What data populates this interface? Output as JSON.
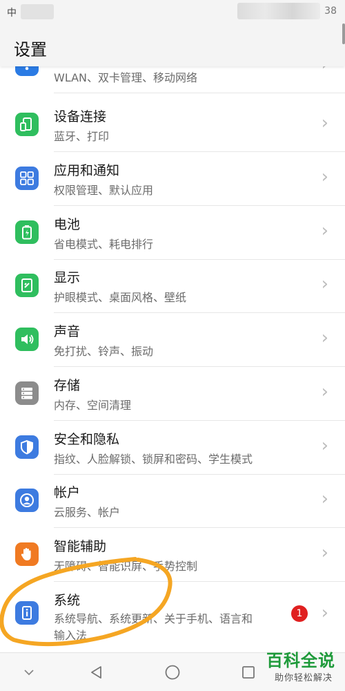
{
  "status_bar": {
    "left_text": "中",
    "right_text": "38"
  },
  "header": {
    "title": "设置"
  },
  "settings": [
    {
      "title": "",
      "subtitle": "WLAN、双卡管理、移动网络",
      "icon": "wifi-icon",
      "color": "#2b7be4"
    },
    {
      "title": "设备连接",
      "subtitle": "蓝牙、打印",
      "icon": "device-connection-icon",
      "color": "#2fbe5e"
    },
    {
      "title": "应用和通知",
      "subtitle": "权限管理、默认应用",
      "icon": "apps-grid-icon",
      "color": "#3d7be0"
    },
    {
      "title": "电池",
      "subtitle": "省电模式、耗电排行",
      "icon": "battery-icon",
      "color": "#2fbe5e"
    },
    {
      "title": "显示",
      "subtitle": "护眼模式、桌面风格、壁纸",
      "icon": "display-icon",
      "color": "#2fbe5e"
    },
    {
      "title": "声音",
      "subtitle": "免打扰、铃声、振动",
      "icon": "speaker-icon",
      "color": "#2fbe5e"
    },
    {
      "title": "存储",
      "subtitle": "内存、空间清理",
      "icon": "storage-icon",
      "color": "#8c8c8c"
    },
    {
      "title": "安全和隐私",
      "subtitle": "指纹、人脸解锁、锁屏和密码、学生模式",
      "icon": "shield-icon",
      "color": "#3d7be0"
    },
    {
      "title": "帐户",
      "subtitle": "云服务、帐户",
      "icon": "account-icon",
      "color": "#3d7be0"
    },
    {
      "title": "智能辅助",
      "subtitle": "无障碍、智能识屏、手势控制",
      "icon": "hand-icon",
      "color": "#f07a22"
    },
    {
      "title": "系统",
      "subtitle": "系统导航、系统更新、关于手机、语言和",
      "subtitle2": "输入法",
      "icon": "system-info-icon",
      "color": "#3d7be0",
      "badge": "1"
    }
  ],
  "watermark": {
    "main": "百科全说",
    "sub": "助你轻松解决"
  },
  "colors": {
    "annotation": "#f5a623",
    "badge": "#e02020",
    "chevron": "#bdbdbd"
  }
}
